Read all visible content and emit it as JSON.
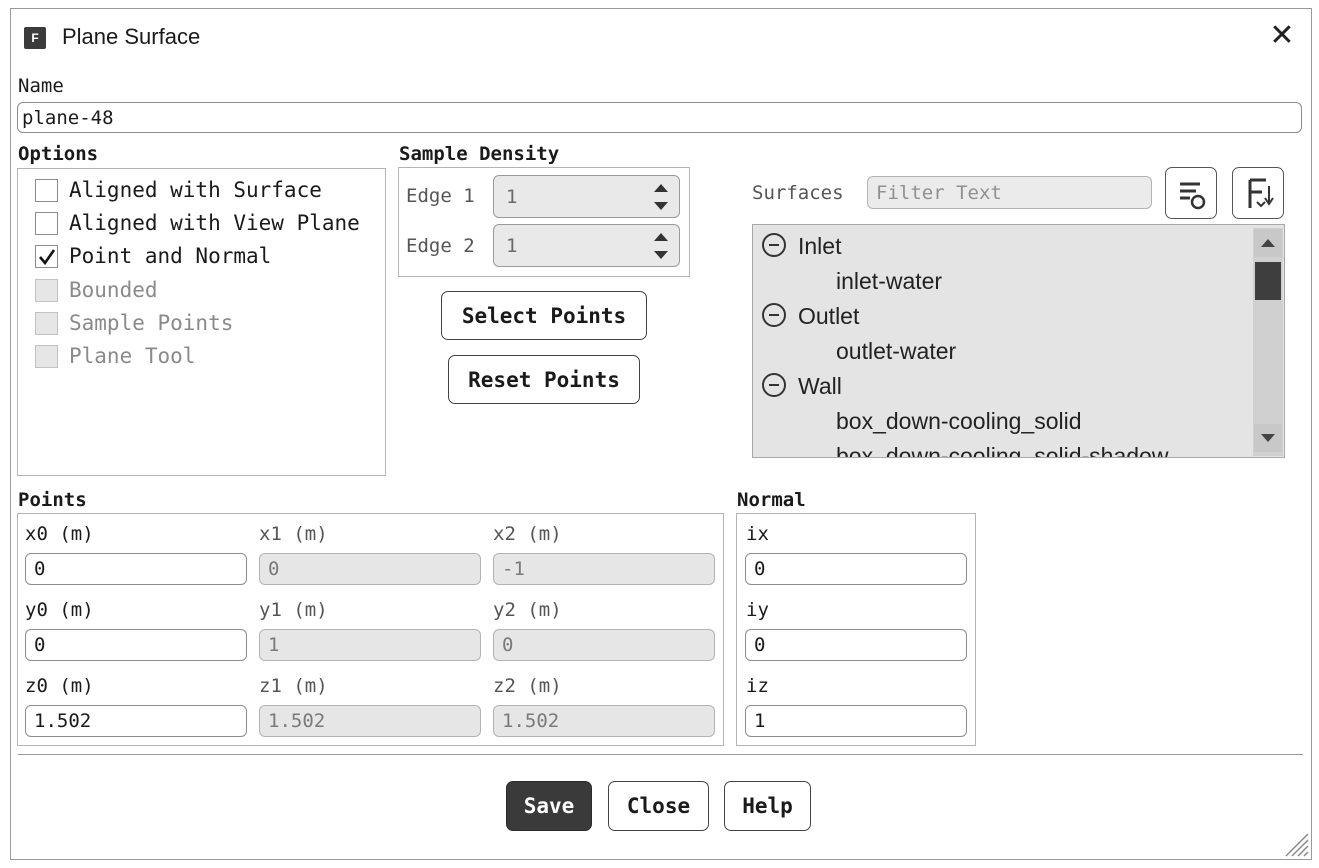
{
  "window": {
    "title": "Plane Surface",
    "app_icon_letter": "F",
    "close_glyph": "✕"
  },
  "name_field": {
    "label": "Name",
    "value": "plane-48"
  },
  "options": {
    "title": "Options",
    "items": [
      {
        "label": "Aligned with Surface",
        "checked": false,
        "enabled": true
      },
      {
        "label": "Aligned with View Plane",
        "checked": false,
        "enabled": true
      },
      {
        "label": "Point and Normal",
        "checked": true,
        "enabled": true
      },
      {
        "label": "Bounded",
        "checked": false,
        "enabled": false
      },
      {
        "label": "Sample Points",
        "checked": false,
        "enabled": false
      },
      {
        "label": "Plane Tool",
        "checked": false,
        "enabled": false
      }
    ]
  },
  "sample_density": {
    "title": "Sample Density",
    "edge1": {
      "label": "Edge 1",
      "value": "1"
    },
    "edge2": {
      "label": "Edge 2",
      "value": "1"
    },
    "select_points_label": "Select Points",
    "reset_points_label": "Reset Points"
  },
  "surfaces": {
    "label": "Surfaces",
    "filter_placeholder": "Filter Text",
    "tree": [
      {
        "group": "Inlet",
        "children": [
          "inlet-water"
        ]
      },
      {
        "group": "Outlet",
        "children": [
          "outlet-water"
        ]
      },
      {
        "group": "Wall",
        "children": [
          "box_down-cooling_solid",
          "box_down-cooling_solid-shadow"
        ]
      }
    ]
  },
  "points": {
    "title": "Points",
    "x0": {
      "label": "x0 (m)",
      "value": "0"
    },
    "x1": {
      "label": "x1 (m)",
      "value": "0"
    },
    "x2": {
      "label": "x2 (m)",
      "value": "-1"
    },
    "y0": {
      "label": "y0 (m)",
      "value": "0"
    },
    "y1": {
      "label": "y1 (m)",
      "value": "1"
    },
    "y2": {
      "label": "y2 (m)",
      "value": "0"
    },
    "z0": {
      "label": "z0 (m)",
      "value": "1.502"
    },
    "z1": {
      "label": "z1 (m)",
      "value": "1.502"
    },
    "z2": {
      "label": "z2 (m)",
      "value": "1.502"
    }
  },
  "normal": {
    "title": "Normal",
    "ix": {
      "label": "ix",
      "value": "0"
    },
    "iy": {
      "label": "iy",
      "value": "0"
    },
    "iz": {
      "label": "iz",
      "value": "1"
    }
  },
  "footer": {
    "save_label": "Save",
    "close_label": "Close",
    "help_label": "Help"
  }
}
